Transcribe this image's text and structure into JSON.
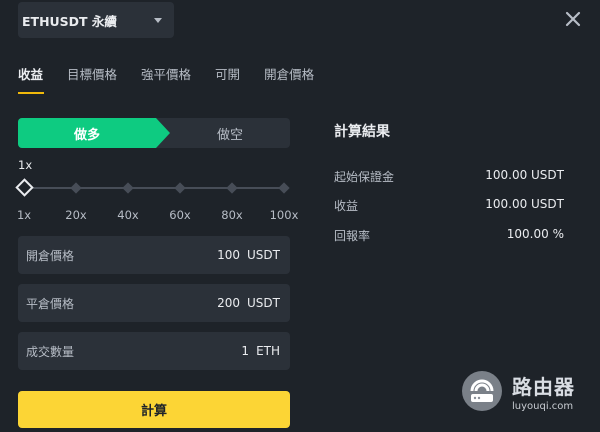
{
  "header": {
    "symbol": "ETHUSDT 永續",
    "icons": {
      "dropdown": "caret-down-icon",
      "close": "close-icon"
    }
  },
  "tabs": [
    {
      "label": "收益",
      "active": true
    },
    {
      "label": "目標價格"
    },
    {
      "label": "強平價格"
    },
    {
      "label": "可開"
    },
    {
      "label": "開倉價格"
    }
  ],
  "side": {
    "long_label": "做多",
    "short_label": "做空",
    "selected": "long"
  },
  "leverage": {
    "current_label": "1x",
    "value": 1,
    "max": 100,
    "ticks": [
      "1x",
      "20x",
      "40x",
      "60x",
      "80x",
      "100x"
    ]
  },
  "inputs": {
    "entry": {
      "label": "開倉價格",
      "value": "100",
      "unit": "USDT"
    },
    "exit": {
      "label": "平倉價格",
      "value": "200",
      "unit": "USDT"
    },
    "qty": {
      "label": "成交數量",
      "value": "1",
      "unit": "ETH"
    }
  },
  "calculate_label": "計算",
  "results": {
    "title": "計算結果",
    "rows": [
      {
        "label": "起始保證金",
        "value": "100.00 USDT"
      },
      {
        "label": "收益",
        "value": "100.00 USDT"
      },
      {
        "label": "回報率",
        "value": "100.00 %"
      }
    ]
  },
  "watermark": {
    "title": "路由器",
    "url": "luyouqi.com"
  },
  "colors": {
    "background": "#1e2329",
    "panel": "#2b3139",
    "long": "#0ecb81",
    "accent": "#fcd535"
  }
}
